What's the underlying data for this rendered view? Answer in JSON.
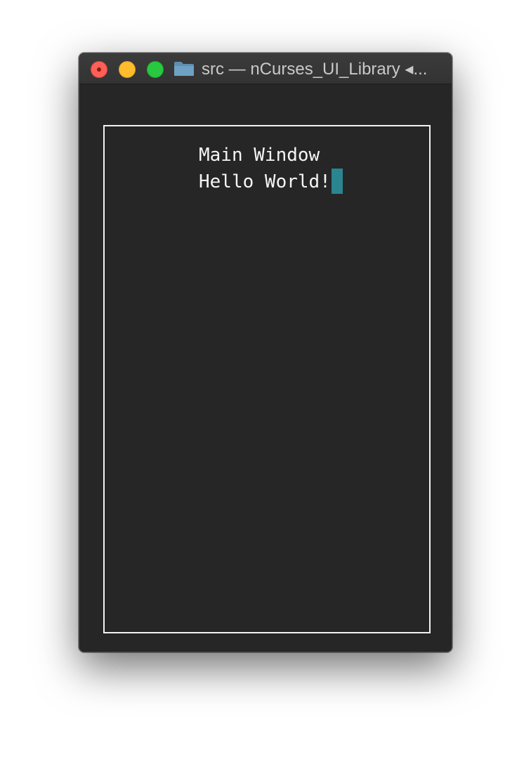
{
  "window": {
    "title": "src — nCurses_UI_Library ◂...",
    "title_icon": "folder-icon",
    "controls": {
      "close": "close-button",
      "minimize": "minimize-button",
      "zoom": "zoom-button"
    }
  },
  "terminal": {
    "lines": [
      "Main Window",
      "Hello World!"
    ],
    "cursor_color": "#2a8591",
    "box_color": "#f2f2f2",
    "background": "#262626"
  }
}
